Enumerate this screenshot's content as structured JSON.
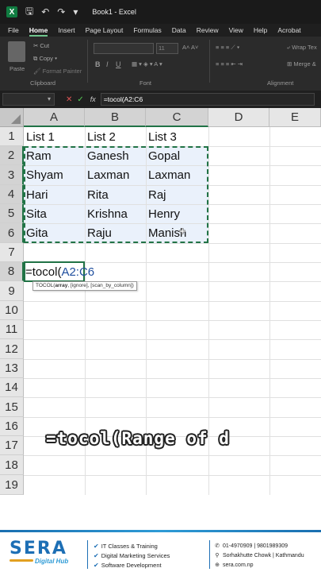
{
  "titlebar": {
    "logo": "X",
    "title": "Book1 - Excel"
  },
  "menu": [
    "File",
    "Home",
    "Insert",
    "Page Layout",
    "Formulas",
    "Data",
    "Review",
    "View",
    "Help",
    "Acrobat"
  ],
  "ribbon": {
    "paste": "Paste",
    "cut": "Cut",
    "copy": "Copy",
    "format_painter": "Format Painter",
    "clipboard_group": "Clipboard",
    "font_size": "11",
    "font_grow": "A˄ A˅",
    "bold": "B",
    "italic": "I",
    "underline": "U",
    "font_group": "Font",
    "wrap_text": "Wrap Tex",
    "merge": "Merge &",
    "alignment_group": "Alignment"
  },
  "formula_bar": {
    "fx": "fx",
    "value": "=tocol(A2:C6"
  },
  "columns": [
    "A",
    "B",
    "C",
    "D",
    "E"
  ],
  "rows": [
    "1",
    "2",
    "3",
    "4",
    "5",
    "6",
    "7",
    "8",
    "9",
    "10",
    "11",
    "12",
    "13",
    "14",
    "15",
    "16",
    "17",
    "18",
    "19"
  ],
  "cells": {
    "header": [
      "List 1",
      "List 2",
      "List 3"
    ],
    "data": [
      [
        "Ram",
        "Ganesh",
        "Gopal"
      ],
      [
        "Shyam",
        "Laxman",
        "Laxman"
      ],
      [
        "Hari",
        "Rita",
        "Raj"
      ],
      [
        "Sita",
        "Krishna",
        "Henry"
      ],
      [
        "Gita",
        "Raju",
        "Manish"
      ]
    ]
  },
  "formula_cell": {
    "prefix": "=tocol(",
    "ref": "A2:C6"
  },
  "tooltip": {
    "fn": "TOCOL(",
    "arg1": "array",
    "rest": ", [ignore], [scan_by_column])"
  },
  "caption": "=tocol(Range of d",
  "footer": {
    "logo": "SERA",
    "logo_sub": "Digital Hub",
    "services": [
      "IT Classes & Training",
      "Digital Marketing Services",
      "Software Development"
    ],
    "phone": "01-4970909 | 9801989309",
    "address": "Sorhakhutte Chowk | Kathmandu",
    "website": "sera.com.np"
  },
  "colors": {
    "excel_green": "#217346",
    "brand_blue": "#1d6fb5"
  }
}
